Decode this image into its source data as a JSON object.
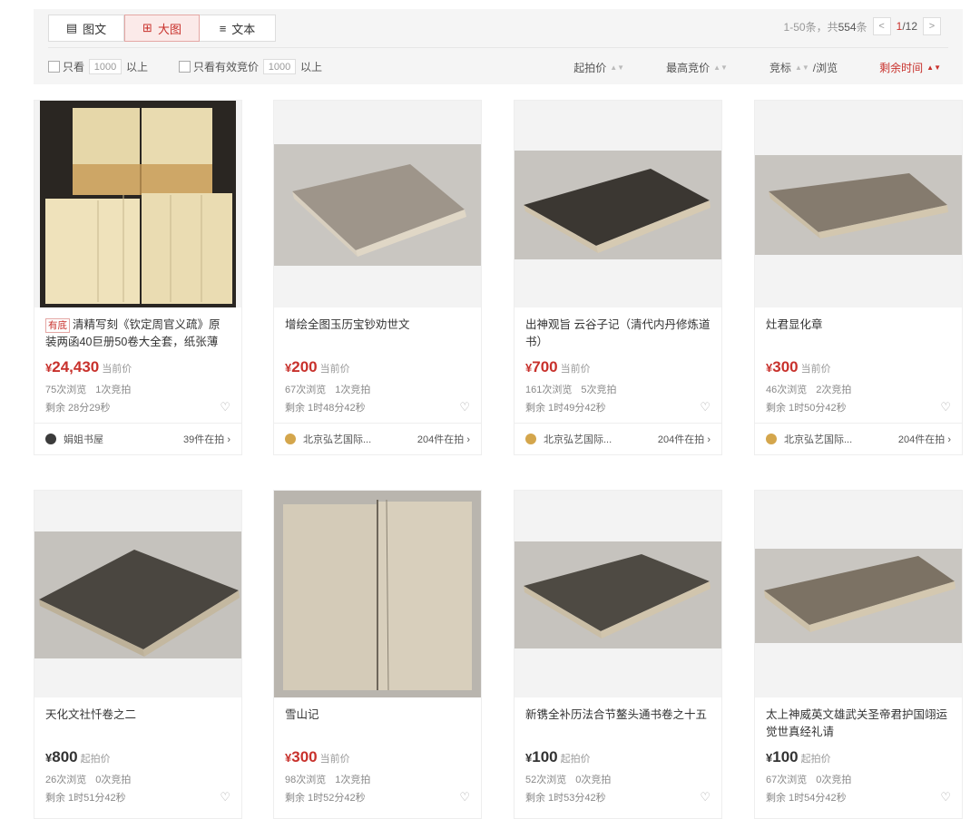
{
  "view_tabs": [
    {
      "label": "图文",
      "icon": "list-grid-icon"
    },
    {
      "label": "大图",
      "icon": "grid-icon"
    },
    {
      "label": "文本",
      "icon": "text-list-icon"
    }
  ],
  "pager": {
    "range": "1-50条，共",
    "total": "554",
    "unit": "条",
    "current": "1",
    "total_pages": "/12",
    "prev": "<",
    "next": ">"
  },
  "filters": {
    "only_views_label": "只看",
    "only_views_value": "1000",
    "only_views_suffix": "以上",
    "valid_bid_label": "只看有效竞价",
    "valid_bid_value": "1000",
    "valid_bid_suffix": "以上"
  },
  "sorts": [
    "起拍价",
    "最高竞价",
    "竞标",
    "/浏览",
    "剩余时间"
  ],
  "items": [
    {
      "tag": "有底",
      "title": "清精写刻《钦定周官义疏》原装两函40巨册50卷大全套，纸张薄如...",
      "yen": "¥",
      "price": "24,430",
      "price_label": "当前价",
      "views": "75次浏览",
      "bids": "1次竞拍",
      "remain": "剩余 28分29秒",
      "shop": "娟姐书屋",
      "shop_count": "39件在拍 ›"
    },
    {
      "title": "增绘全图玉历宝钞劝世文",
      "yen": "¥",
      "price": "200",
      "price_label": "当前价",
      "views": "67次浏览",
      "bids": "1次竞拍",
      "remain": "剩余 1时48分42秒",
      "shop": "北京弘艺国际...",
      "shop_count": "204件在拍 ›"
    },
    {
      "title": "出神观旨 云谷子记（清代内丹修炼道书）",
      "yen": "¥",
      "price": "700",
      "price_label": "当前价",
      "views": "161次浏览",
      "bids": "5次竞拍",
      "remain": "剩余 1时49分42秒",
      "shop": "北京弘艺国际...",
      "shop_count": "204件在拍 ›"
    },
    {
      "title": "灶君显化章",
      "yen": "¥",
      "price": "300",
      "price_label": "当前价",
      "views": "46次浏览",
      "bids": "2次竞拍",
      "remain": "剩余 1时50分42秒",
      "shop": "北京弘艺国际...",
      "shop_count": "204件在拍 ›"
    },
    {
      "title": "天化文社忏卷之二",
      "yen": "¥",
      "price": "800",
      "price_label": "起拍价",
      "views": "26次浏览",
      "bids": "0次竞拍",
      "remain": "剩余 1时51分42秒"
    },
    {
      "title": "雪山记",
      "yen": "¥",
      "price": "300",
      "price_label": "当前价",
      "views": "98次浏览",
      "bids": "1次竞拍",
      "remain": "剩余 1时52分42秒"
    },
    {
      "title": "新镌全补历法合节鳌头通书卷之十五",
      "yen": "¥",
      "price": "100",
      "price_label": "起拍价",
      "views": "52次浏览",
      "bids": "0次竞拍",
      "remain": "剩余 1时53分42秒"
    },
    {
      "title": "太上神威英文雄武关圣帝君护国翊运觉世真经礼请",
      "yen": "¥",
      "price": "100",
      "price_label": "起拍价",
      "views": "67次浏览",
      "bids": "0次竞拍",
      "remain": "剩余 1时54分42秒"
    }
  ],
  "colors": {
    "accent": "#c8312c",
    "toolbar_bg": "#f5f5f5"
  }
}
